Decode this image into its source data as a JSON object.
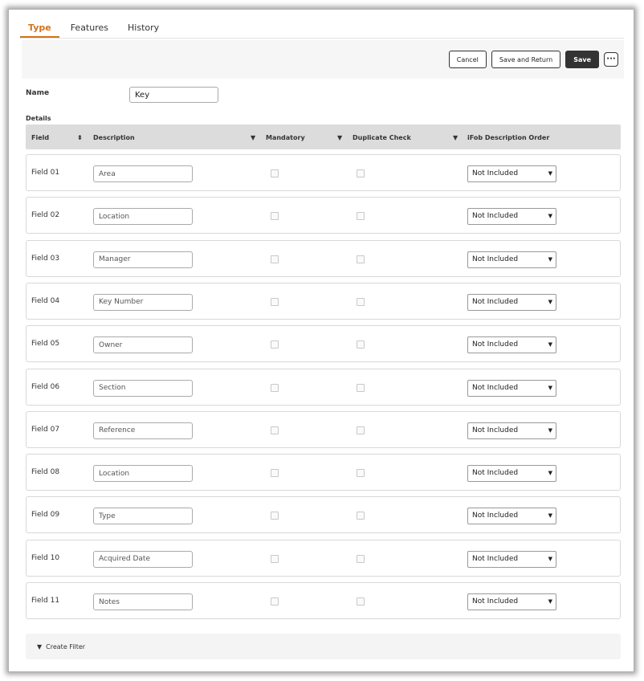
{
  "tabs": [
    {
      "label": "Type",
      "active": true
    },
    {
      "label": "Features",
      "active": false
    },
    {
      "label": "History",
      "active": false
    }
  ],
  "toolbar": {
    "cancel_label": "Cancel",
    "save_return_label": "Save and Return",
    "save_label": "Save",
    "more_label": "···"
  },
  "form": {
    "name_label": "Name",
    "name_value": "Key",
    "details_label": "Details"
  },
  "table": {
    "columns": {
      "field": "Field",
      "description": "Description",
      "mandatory": "Mandatory",
      "duplicate_check": "Duplicate Check",
      "ifob_order": "iFob Description Order"
    },
    "icons": {
      "sort": "sort-icon",
      "filter": "filter-icon"
    },
    "rows": [
      {
        "field": "Field 01",
        "description": "Area",
        "mandatory": false,
        "duplicate_check": false,
        "order": "Not Included"
      },
      {
        "field": "Field 02",
        "description": "Location",
        "mandatory": false,
        "duplicate_check": false,
        "order": "Not Included"
      },
      {
        "field": "Field 03",
        "description": "Manager",
        "mandatory": false,
        "duplicate_check": false,
        "order": "Not Included"
      },
      {
        "field": "Field 04",
        "description": "Key Number",
        "mandatory": false,
        "duplicate_check": false,
        "order": "Not Included"
      },
      {
        "field": "Field 05",
        "description": "Owner",
        "mandatory": false,
        "duplicate_check": false,
        "order": "Not Included"
      },
      {
        "field": "Field 06",
        "description": "Section",
        "mandatory": false,
        "duplicate_check": false,
        "order": "Not Included"
      },
      {
        "field": "Field 07",
        "description": "Reference",
        "mandatory": false,
        "duplicate_check": false,
        "order": "Not Included"
      },
      {
        "field": "Field 08",
        "description": "Location",
        "mandatory": false,
        "duplicate_check": false,
        "order": "Not Included"
      },
      {
        "field": "Field 09",
        "description": "Type",
        "mandatory": false,
        "duplicate_check": false,
        "order": "Not Included"
      },
      {
        "field": "Field 10",
        "description": "Acquired Date",
        "mandatory": false,
        "duplicate_check": false,
        "order": "Not Included"
      },
      {
        "field": "Field 11",
        "description": "Notes",
        "mandatory": false,
        "duplicate_check": false,
        "order": "Not Included"
      }
    ]
  },
  "footer": {
    "create_filter_label": "Create Filter"
  },
  "colors": {
    "accent": "#d4731c",
    "dark_button": "#333333",
    "header_bg": "#dcdcdc"
  }
}
